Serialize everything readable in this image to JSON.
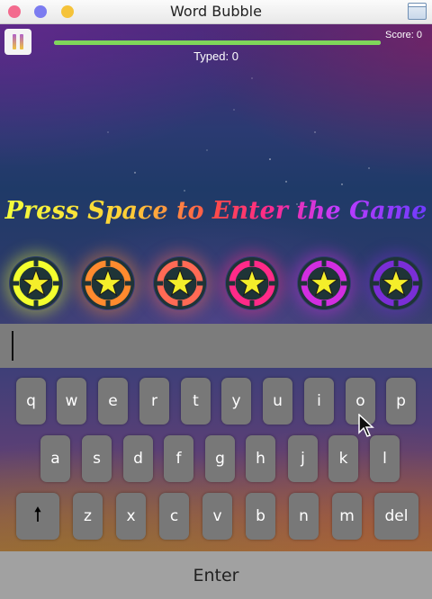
{
  "window": {
    "title": "Word Bubble"
  },
  "hud": {
    "score_text": "Score: 0",
    "typed_text": "Typed: 0",
    "progress_fraction": 1.0
  },
  "prompt": "Press Space to Enter the Game",
  "bubbles": [
    {
      "color": "#f3ff2e",
      "icon": "star-icon"
    },
    {
      "color": "#ff8a2e",
      "icon": "star-icon"
    },
    {
      "color": "#ff6a55",
      "icon": "star-icon"
    },
    {
      "color": "#ff2a88",
      "icon": "star-icon"
    },
    {
      "color": "#d12ee0",
      "icon": "star-icon"
    },
    {
      "color": "#7a2ed6",
      "icon": "star-icon"
    }
  ],
  "input": {
    "value": ""
  },
  "keyboard": {
    "row1": [
      "q",
      "w",
      "e",
      "r",
      "t",
      "y",
      "u",
      "i",
      "o",
      "p"
    ],
    "row2": [
      "a",
      "s",
      "d",
      "f",
      "g",
      "h",
      "j",
      "k",
      "l"
    ],
    "row3": [
      "z",
      "x",
      "c",
      "v",
      "b",
      "n",
      "m"
    ],
    "shift_icon": "up-arrow-icon",
    "delete_label": "del"
  },
  "enter_label": "Enter"
}
